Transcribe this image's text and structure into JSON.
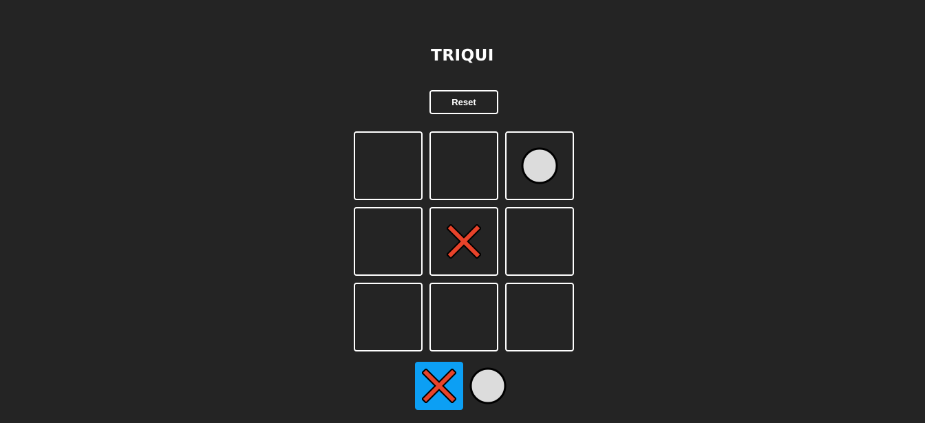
{
  "title": "TRIQUI",
  "reset_label": "Reset",
  "board": [
    "",
    "",
    "O",
    "",
    "X",
    "",
    "",
    "",
    ""
  ],
  "turn": {
    "current": "X",
    "players": [
      "X",
      "O"
    ]
  },
  "colors": {
    "background": "#242424",
    "border": "#ffffff",
    "x_fill": "#e8432a",
    "x_outline": "#000000",
    "o_fill": "#dcdcdc",
    "o_outline": "#000000",
    "active_turn": "#0c9ff4"
  },
  "icons": {
    "X": "x-mark-icon",
    "O": "circle-icon"
  }
}
